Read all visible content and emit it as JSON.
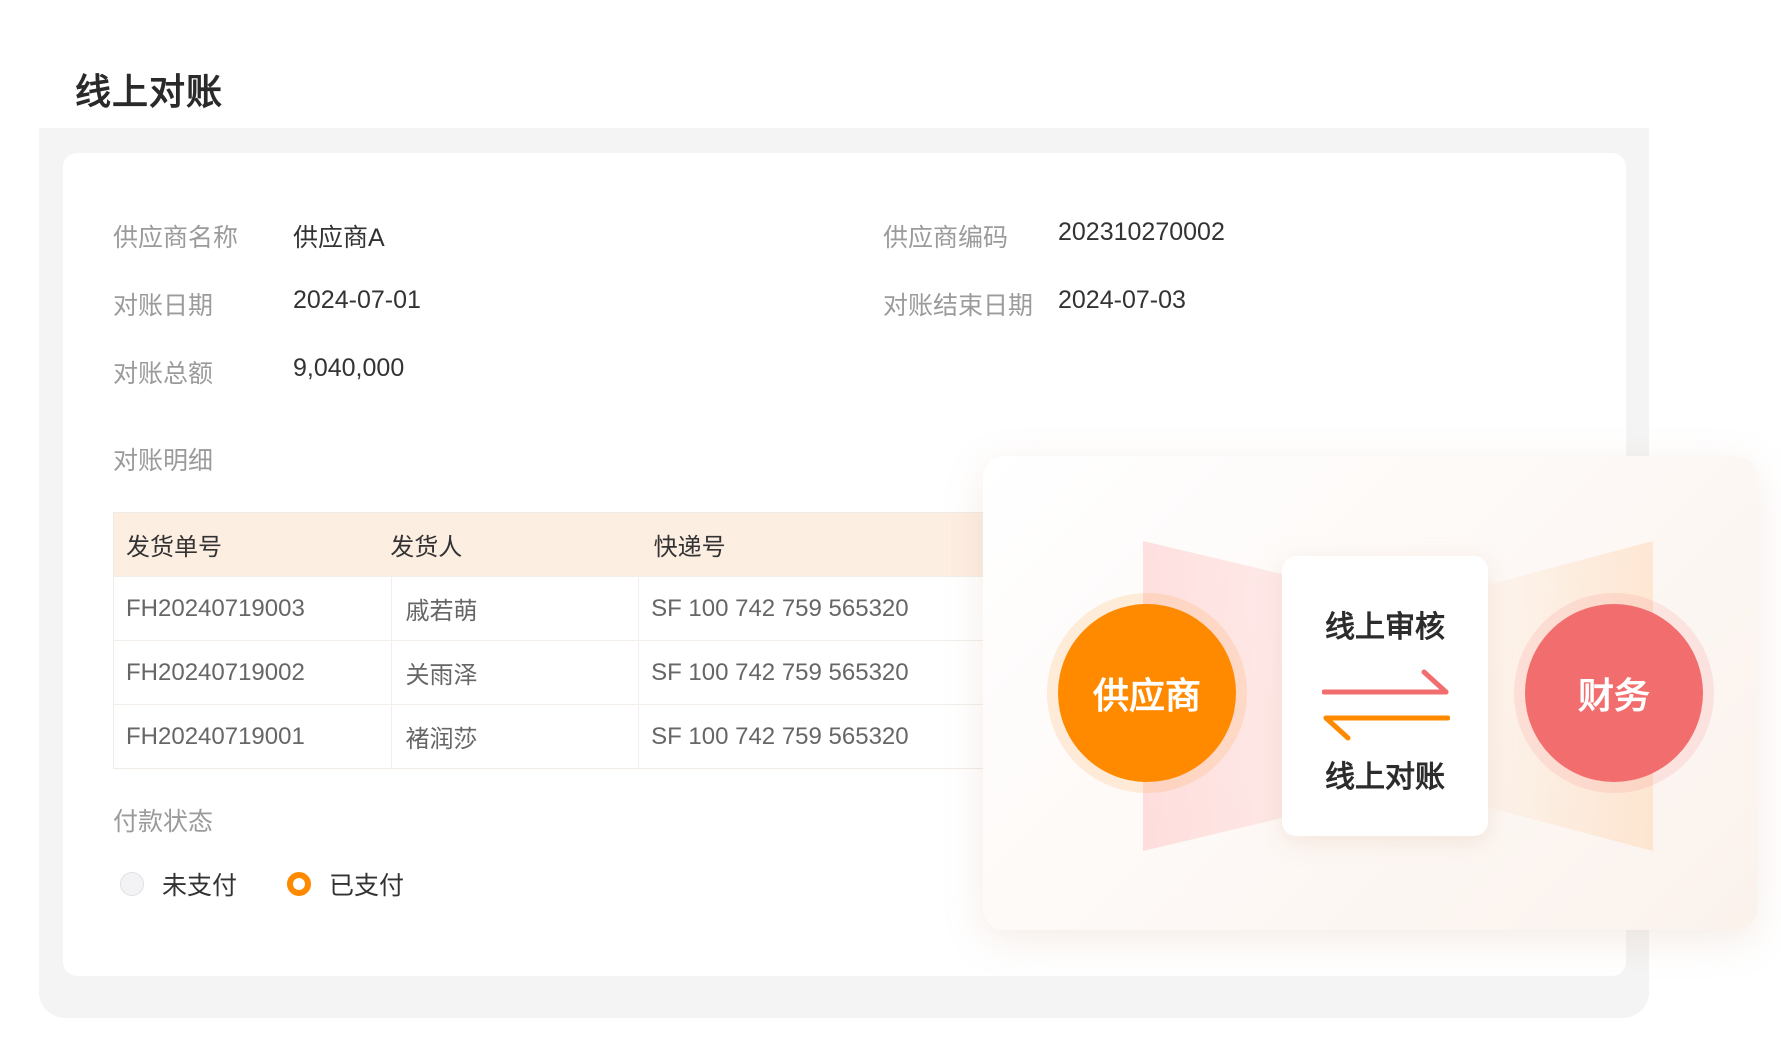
{
  "page": {
    "title": "线上对账"
  },
  "fields": {
    "supplier_name_label": "供应商名称",
    "supplier_name_value": "供应商A",
    "supplier_code_label": "供应商编码",
    "supplier_code_value": "202310270002",
    "date_label": "对账日期",
    "date_value": "2024-07-01",
    "end_date_label": "对账结束日期",
    "end_date_value": "2024-07-03",
    "total_label": "对账总额",
    "total_value": "9,040,000"
  },
  "details": {
    "label": "对账明细",
    "columns": [
      "发货单号",
      "发货人",
      "快递号"
    ],
    "rows": [
      [
        "FH20240719003",
        "戚若萌",
        "SF 100 742 759 565320"
      ],
      [
        "FH20240719002",
        "关雨泽",
        "SF 100 742 759 565320"
      ],
      [
        "FH20240719001",
        "褚润莎",
        "SF 100 742 759 565320"
      ]
    ]
  },
  "payment": {
    "label": "付款状态",
    "options": [
      "未支付",
      "已支付"
    ],
    "selected": "已支付"
  },
  "flow": {
    "left_node": "供应商",
    "right_node": "财务",
    "top_text": "线上审核",
    "bottom_text": "线上对账",
    "colors": {
      "supplier": "#ff8a00",
      "finance": "#f26e6e"
    }
  }
}
